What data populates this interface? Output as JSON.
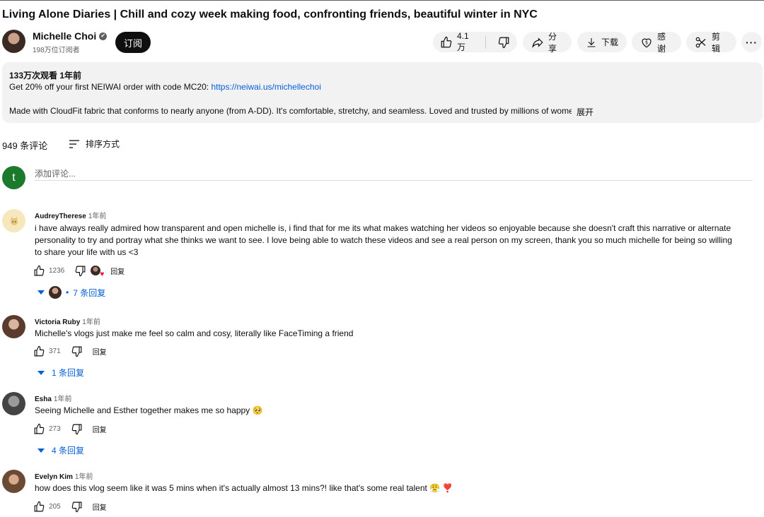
{
  "video": {
    "title": "Living Alone Diaries | Chill and cozy week making food, confronting friends, beautiful winter in NYC",
    "channel": {
      "name": "Michelle Choi",
      "verified_icon": "✔",
      "subscribers": "198万位订阅者",
      "subscribe_label": "订阅"
    },
    "actions": {
      "like_count": "4.1万",
      "share_label": "分享",
      "download_label": "下载",
      "thanks_label": "感谢",
      "clip_label": "剪辑",
      "more_label": "···"
    }
  },
  "description": {
    "meta": "133万次观看  1年前",
    "promo_text": "Get 20% off your first NEIWAI order with code MC20: ",
    "promo_link": "https://neiwai.us/michellechoi",
    "body": "Made with CloudFit fabric that conforms to nearly anyone (from A-DD). It's comfortable, stretchy, and seamless. Loved and trusted by millions of women!",
    "expand_label": "展开"
  },
  "comments_header": {
    "count_label": "949 条评论",
    "sort_label": "排序方式"
  },
  "add_comment": {
    "avatar_letter": "t",
    "placeholder": "添加评论..."
  },
  "comments": [
    {
      "author": "AudreyTherese",
      "time": "1年前",
      "text": "i have always really admired how transparent and open michelle is, i find that for me its what makes watching her videos so enjoyable because she doesn't craft this narrative or alternate personality to try and portray what she thinks we want to see. I love being able to watch these videos and see a real person on my screen, thank you so much michelle for being so willing to share your life with us <3",
      "likes": "1236",
      "reply_label": "回复",
      "heart_icon": "♥",
      "replies_label": "7 条回复",
      "replies_dot": "•"
    },
    {
      "author": "Victoria Ruby",
      "time": "1年前",
      "text": "Michelle's vlogs just make me feel so calm and cosy, literally like FaceTiming a friend",
      "likes": "371",
      "reply_label": "回复",
      "replies_label": "1 条回复"
    },
    {
      "author": "Esha",
      "time": "1年前",
      "text": "Seeing Michelle and Esther together makes me so happy 🥺",
      "likes": "273",
      "reply_label": "回复",
      "replies_label": "4 条回复"
    },
    {
      "author": "Evelyn Kim",
      "time": "1年前",
      "text": "how does this vlog seem like it was 5 mins when it's actually almost 13 mins?! like that's some real talent 😤 ❣️",
      "likes": "205",
      "reply_label": "回复"
    }
  ],
  "colors": {
    "link": "#065fd4",
    "pill_bg": "#f2f2f2",
    "subscribe_bg": "#0f0f0f",
    "my_avatar": "#1b7a2b"
  }
}
